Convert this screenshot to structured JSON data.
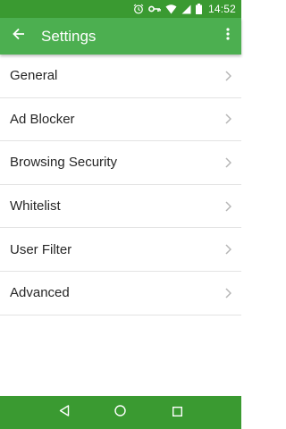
{
  "status_bar": {
    "time": "14:52",
    "icons": [
      "alarm-icon",
      "key-icon",
      "wifi-icon",
      "signal-icon",
      "battery-icon"
    ]
  },
  "app_bar": {
    "title": "Settings",
    "back_icon": "arrow-back-icon",
    "overflow_icon": "more-vert-icon"
  },
  "settings": {
    "items": [
      {
        "label": "General"
      },
      {
        "label": "Ad Blocker"
      },
      {
        "label": "Browsing Security"
      },
      {
        "label": "Whitelist"
      },
      {
        "label": "User Filter"
      },
      {
        "label": "Advanced"
      }
    ]
  },
  "nav_bar": {
    "buttons": [
      "back-triangle-icon",
      "home-circle-icon",
      "recents-square-icon"
    ]
  },
  "colors": {
    "status_bar": "#3a9a31",
    "app_bar": "#4caf50",
    "nav_bar": "#3a9a31",
    "text": "#262626",
    "chevron": "#b5b5b5"
  }
}
